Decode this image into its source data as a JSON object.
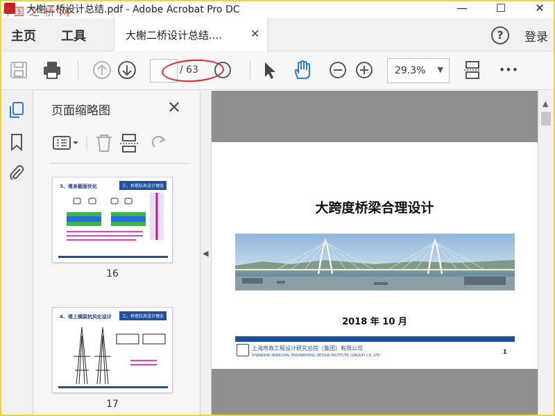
{
  "window": {
    "title": "大榭二桥设计总结.pdf - Adobe Acrobat Pro DC",
    "watermark": "中国 之 桥 网",
    "minimize": "—",
    "maximize": "☐",
    "close": "✕"
  },
  "tabs": {
    "home": "主页",
    "tools": "工具",
    "document": "大榭二桥设计总结....",
    "document_close": "✕",
    "help": "?",
    "login": "登录"
  },
  "toolbar": {
    "current_page": "",
    "total_pages": "/ 63",
    "zoom": "29.3%",
    "zoom_caret": "▼",
    "more": "•••"
  },
  "thumbnail_panel": {
    "title": "页面缩略图",
    "close": "✕",
    "thumbnails": [
      {
        "page": "16",
        "heading": "3、塔身截面优化",
        "tag": "三、桥塔抗风设计理念"
      },
      {
        "page": "17",
        "heading": "4、塔上横梁抗风化设计",
        "tag": "三、桥塔抗风设计理念"
      }
    ]
  },
  "document": {
    "title": "大跨度桥梁合理设计",
    "date": "2018 年 10 月",
    "org_cn": "上海市政工程设计研究总院（集团）有限公司",
    "org_en": "SHANGHAI MUNICIPAL ENGINEERING DESIGN INSTITUTE (GROUP) CO.,LTD.",
    "page_number": "1"
  },
  "colors": {
    "brand_blue": "#1f4e9e",
    "annotation_red": "#d9262b",
    "toolbar_blue": "#2a7ad5"
  }
}
